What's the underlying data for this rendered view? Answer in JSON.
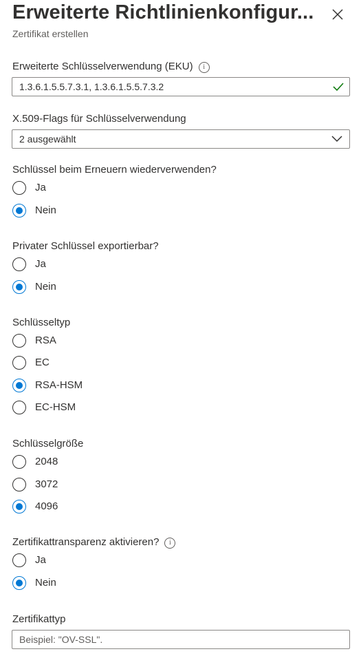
{
  "header": {
    "title": "Erweiterte Richtlinienkonfigur...",
    "subtitle": "Zertifikat erstellen"
  },
  "eku": {
    "label": "Erweiterte Schlüsselverwendung (EKU)",
    "value": "1.3.6.1.5.5.7.3.1, 1.3.6.1.5.5.7.3.2"
  },
  "x509": {
    "label": "X.509-Flags für Schlüsselverwendung",
    "value": "2 ausgewählt"
  },
  "reuse_key": {
    "label": "Schlüssel beim Erneuern wiederverwenden?",
    "options": [
      "Ja",
      "Nein"
    ],
    "selected": "Nein"
  },
  "exportable": {
    "label": "Privater Schlüssel exportierbar?",
    "options": [
      "Ja",
      "Nein"
    ],
    "selected": "Nein"
  },
  "key_type": {
    "label": "Schlüsseltyp",
    "options": [
      "RSA",
      "EC",
      "RSA-HSM",
      "EC-HSM"
    ],
    "selected": "RSA-HSM"
  },
  "key_size": {
    "label": "Schlüsselgröße",
    "options": [
      "2048",
      "3072",
      "4096"
    ],
    "selected": "4096"
  },
  "transparency": {
    "label": "Zertifikattransparenz aktivieren?",
    "options": [
      "Ja",
      "Nein"
    ],
    "selected": "Nein"
  },
  "cert_type": {
    "label": "Zertifikattyp",
    "placeholder": "Beispiel: \"OV-SSL\"."
  },
  "colors": {
    "accent": "#0078d4",
    "valid": "#107c10"
  }
}
